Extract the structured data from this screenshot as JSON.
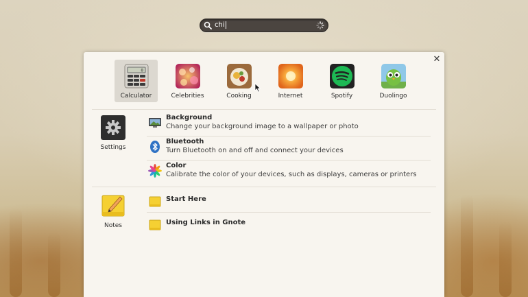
{
  "search": {
    "query": "chi"
  },
  "apps": [
    {
      "label": "Calculator",
      "icon": "calculator-icon",
      "selected": true
    },
    {
      "label": "Celebrities",
      "icon": "celebrities-icon",
      "selected": false
    },
    {
      "label": "Cooking",
      "icon": "cooking-icon",
      "selected": false
    },
    {
      "label": "Internet",
      "icon": "internet-icon",
      "selected": false
    },
    {
      "label": "Spotify",
      "icon": "spotify-icon",
      "selected": false
    },
    {
      "label": "Duolingo",
      "icon": "duolingo-icon",
      "selected": false
    }
  ],
  "settings": {
    "label": "Settings",
    "icon": "gear-icon",
    "results": [
      {
        "title": "Background",
        "description": "Change your background image to a wallpaper or photo",
        "icon": "monitor-icon"
      },
      {
        "title": "Bluetooth",
        "description": "Turn Bluetooth on and off and connect your devices",
        "icon": "bluetooth-icon"
      },
      {
        "title": "Color",
        "description": "Calibrate the color of your devices, such as displays, cameras or printers",
        "icon": "color-wheel-icon"
      }
    ]
  },
  "notes": {
    "label": "Notes",
    "icon": "notes-icon",
    "results": [
      {
        "title": "Start Here",
        "icon": "note-icon"
      },
      {
        "title": "Using Links in Gnote",
        "icon": "note-icon"
      }
    ]
  },
  "colors": {
    "panel": "#f8f5ef",
    "search_bg": "#4b4540",
    "selection": "#dcd8d0",
    "spotify": "#1db954"
  }
}
